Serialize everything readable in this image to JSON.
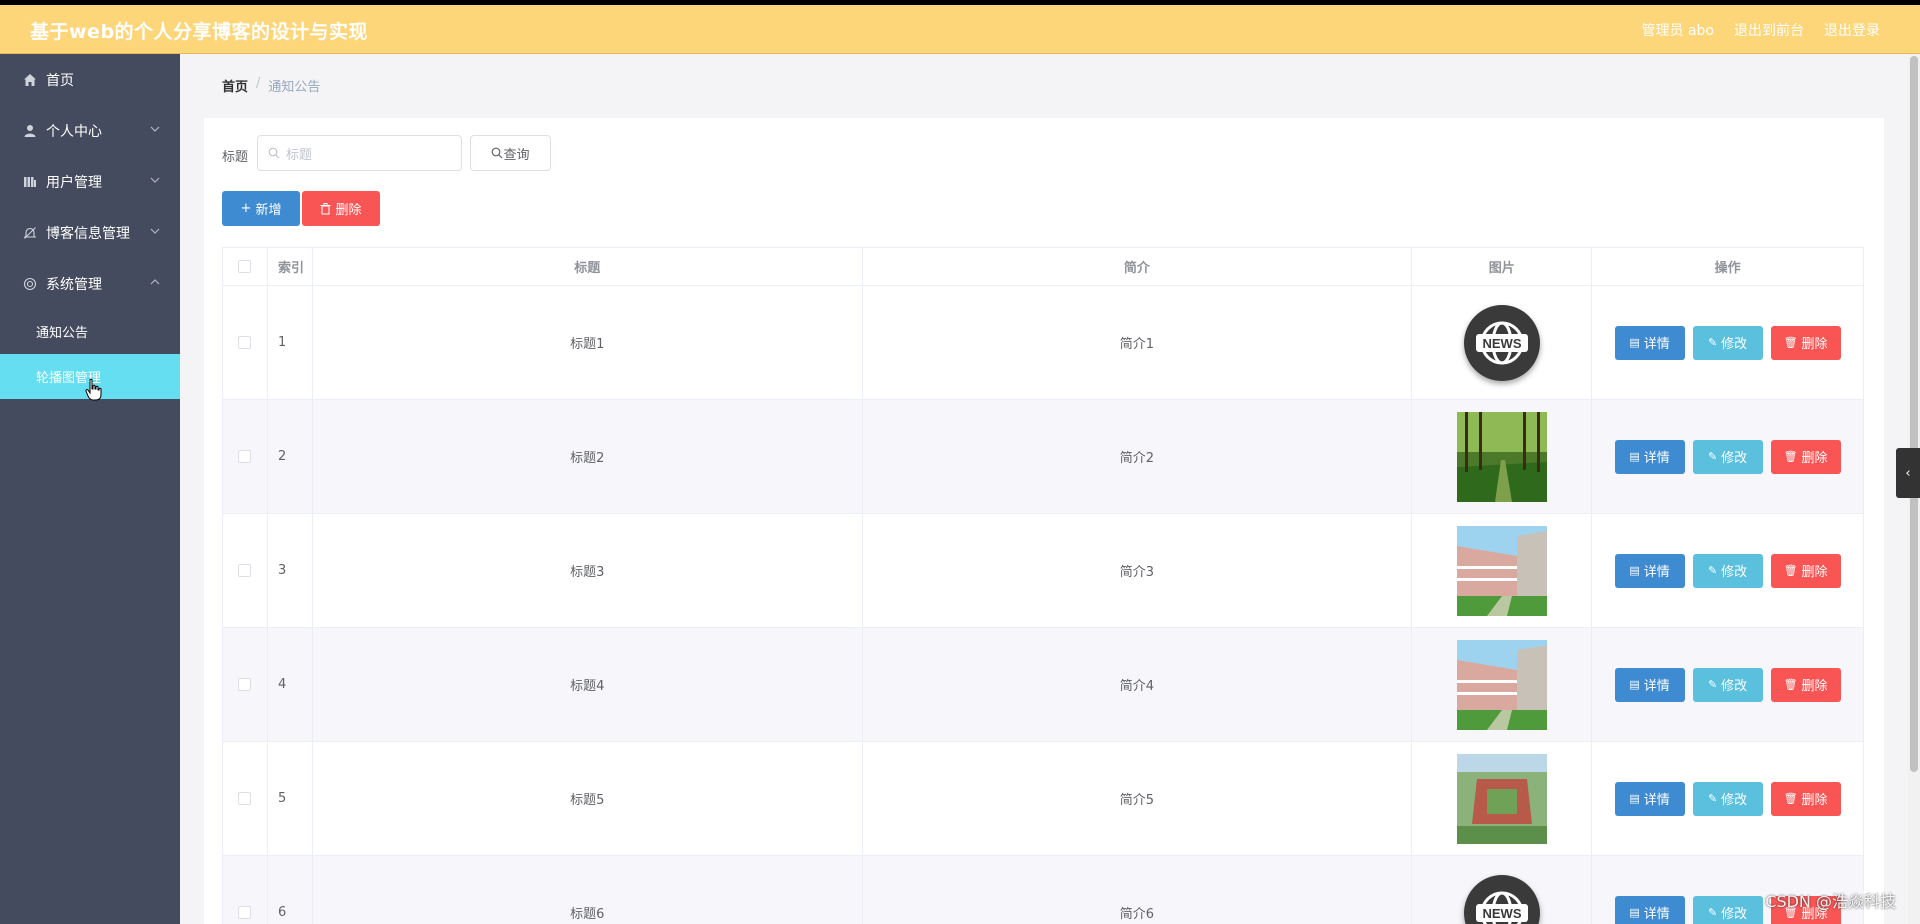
{
  "header": {
    "title": "基于web的个人分享博客的设计与实现",
    "admin_label": "管理员 abo",
    "back_label": "退出到前台",
    "logout_label": "退出登录"
  },
  "sidebar": {
    "items": [
      {
        "label": "首页",
        "icon": "home-icon"
      },
      {
        "label": "个人中心",
        "icon": "user-icon"
      },
      {
        "label": "用户管理",
        "icon": "bars-icon"
      },
      {
        "label": "博客信息管理",
        "icon": "bell-off-icon"
      },
      {
        "label": "系统管理",
        "icon": "settings-icon"
      }
    ],
    "sub_items": [
      {
        "label": "通知公告",
        "active": false
      },
      {
        "label": "轮播图管理",
        "active": true
      }
    ]
  },
  "breadcrumb": {
    "home": "首页",
    "separator": "/",
    "current": "通知公告"
  },
  "search": {
    "label": "标题",
    "placeholder": "标题",
    "query_label": "查询"
  },
  "toolbar": {
    "add_label": "新增",
    "delete_label": "删除"
  },
  "table": {
    "columns": [
      "索引",
      "标题",
      "简介",
      "图片",
      "操作"
    ],
    "rows": [
      {
        "index": "1",
        "title": "标题1",
        "desc": "简介1",
        "image": "news-logo"
      },
      {
        "index": "2",
        "title": "标题2",
        "desc": "简介2",
        "image": "forest-path-photo"
      },
      {
        "index": "3",
        "title": "标题3",
        "desc": "简介3",
        "image": "campus-building-photo"
      },
      {
        "index": "4",
        "title": "标题4",
        "desc": "简介4",
        "image": "campus-building-photo"
      },
      {
        "index": "5",
        "title": "标题5",
        "desc": "简介5",
        "image": "campus-aerial-photo"
      },
      {
        "index": "6",
        "title": "标题6",
        "desc": "简介6",
        "image": "news-logo"
      }
    ],
    "row_actions": {
      "detail": "详情",
      "edit": "修改",
      "delete": "删除"
    },
    "news_logo_text": "NEWS"
  },
  "watermark": "CSDN @浩焱科技",
  "colors": {
    "header_bg": "#fdd67a",
    "sidebar_bg": "#454b5e",
    "active_sub_bg": "#64def0",
    "primary": "#3e8bd1",
    "info": "#5bc0de",
    "danger": "#fa5555"
  }
}
